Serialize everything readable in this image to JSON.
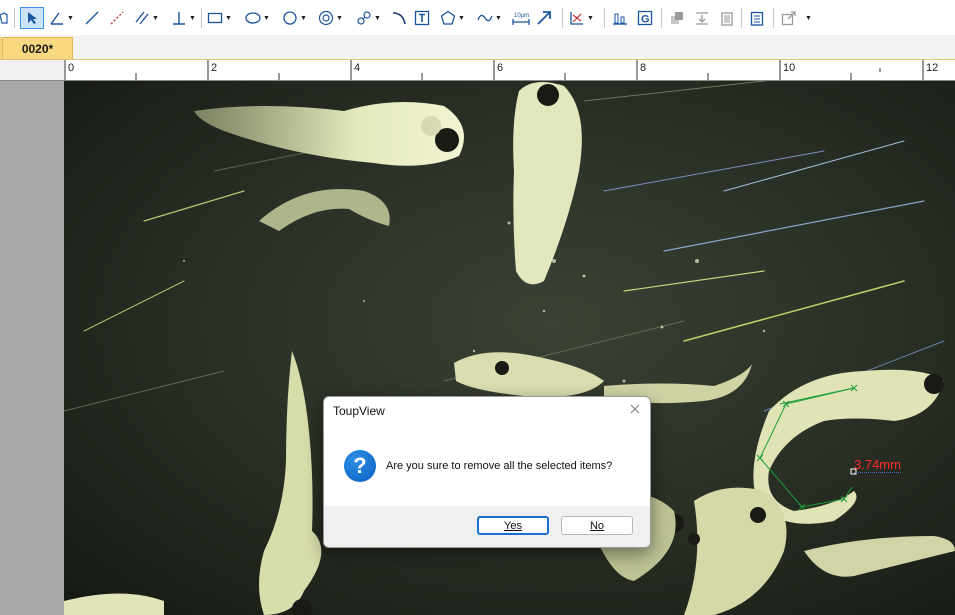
{
  "document": {
    "tab_label": "0020*"
  },
  "ruler": {
    "labels": [
      "0",
      "2",
      "4",
      "6",
      "8",
      "10",
      "12"
    ]
  },
  "measurement": {
    "label": "3.74mm",
    "color": "#ff2a2a",
    "line_color": "#1c9c3a"
  },
  "dialog": {
    "title": "ToupView",
    "message": "Are you sure to remove all the selected items?",
    "yes_label": "Yes",
    "no_label": "No",
    "icon": "question-icon"
  },
  "colors": {
    "accent": "#1c6fd1",
    "tab": "#f8d982"
  }
}
